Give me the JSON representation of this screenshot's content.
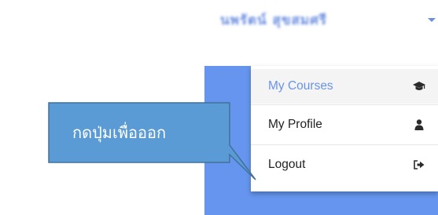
{
  "header": {
    "user_name": "นพรัตน์ สุขสมศรี"
  },
  "menu": {
    "items": [
      {
        "label": "My Courses",
        "icon": "graduation-cap-icon"
      },
      {
        "label": "My Profile",
        "icon": "user-icon"
      },
      {
        "label": "Logout",
        "icon": "sign-out-icon"
      }
    ],
    "active_color": "#6a93e8"
  },
  "callout": {
    "text": "กดปุ่มเพื่อออก",
    "fill": "#5b9bd5",
    "border": "#41719c"
  },
  "colors": {
    "panel_blue": "#6595ee"
  }
}
